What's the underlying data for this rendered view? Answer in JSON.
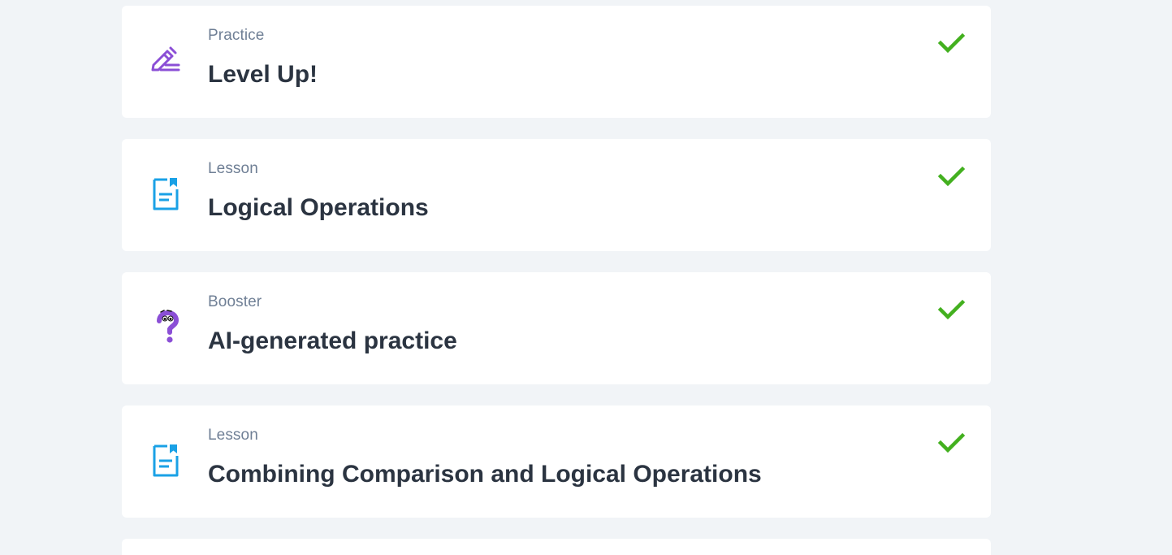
{
  "colors": {
    "background": "#f1f4f7",
    "card": "#ffffff",
    "type_label": "#6f7f95",
    "title": "#2b3441",
    "check": "#43b01f",
    "practice_icon": "#8b4fd6",
    "lesson_icon": "#1aa1e6",
    "booster_icon": "#8b4fd6"
  },
  "items": [
    {
      "type": "Practice",
      "title": "Level Up!",
      "icon": "pencil-icon",
      "completed": true
    },
    {
      "type": "Lesson",
      "title": "Logical Operations",
      "icon": "lesson-document-icon",
      "completed": true
    },
    {
      "type": "Booster",
      "title": "AI-generated practice",
      "icon": "question-mark-character-icon",
      "completed": true
    },
    {
      "type": "Lesson",
      "title": "Combining Comparison and Logical Operations",
      "icon": "lesson-document-icon",
      "completed": true
    }
  ]
}
